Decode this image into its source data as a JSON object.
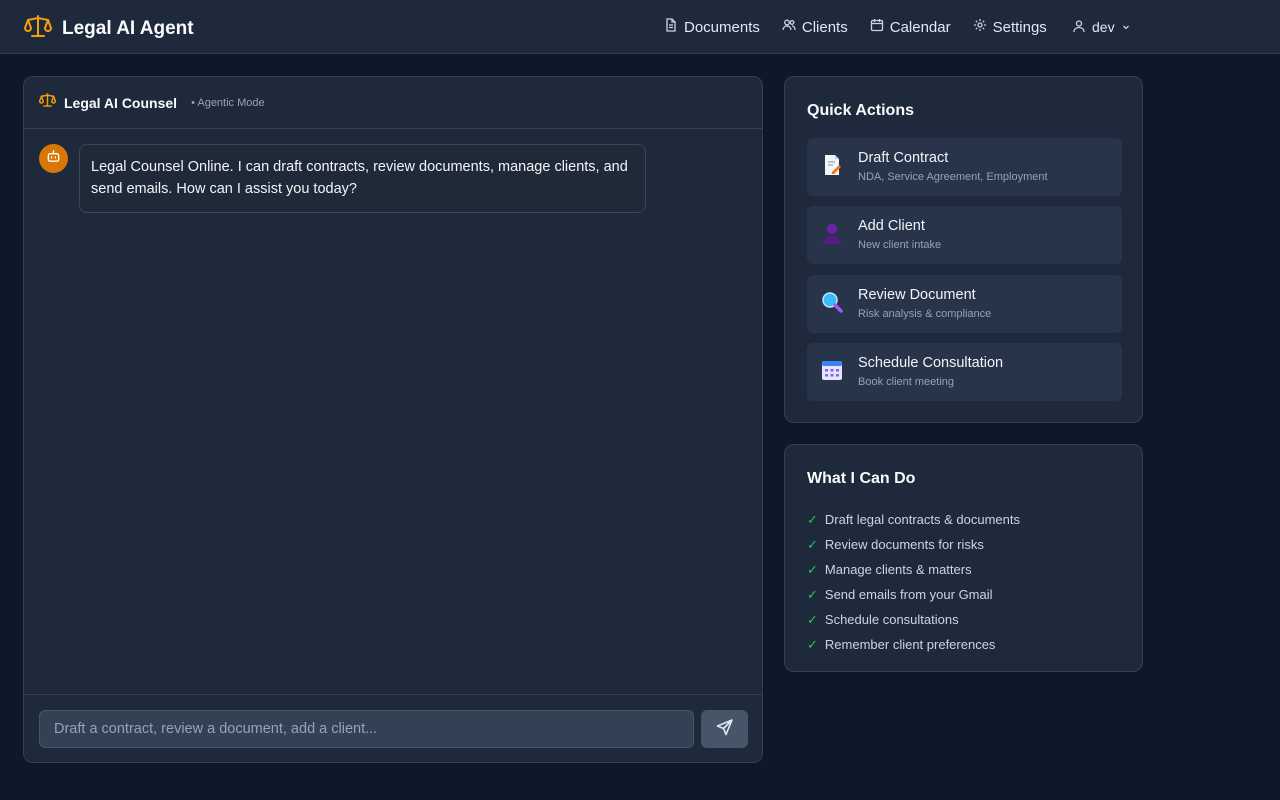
{
  "header": {
    "brand": "Legal AI Agent",
    "nav": [
      {
        "label": "Documents",
        "icon": "document-icon"
      },
      {
        "label": "Clients",
        "icon": "users-icon"
      },
      {
        "label": "Calendar",
        "icon": "calendar-icon"
      },
      {
        "label": "Settings",
        "icon": "gear-icon"
      }
    ],
    "user": "dev"
  },
  "chat": {
    "title": "Legal AI Counsel",
    "mode": "• Agentic Mode",
    "messages": [
      {
        "from": "bot",
        "text": "Legal Counsel Online. I can draft contracts, review documents, manage clients, and send emails. How can I assist you today?"
      }
    ],
    "input_placeholder": "Draft a contract, review a document, add a client...",
    "input_value": ""
  },
  "quick_actions": {
    "title": "Quick Actions",
    "items": [
      {
        "label": "Draft Contract",
        "sub": "NDA, Service Agreement, Employment",
        "icon": "memo-icon"
      },
      {
        "label": "Add Client",
        "sub": "New client intake",
        "icon": "person-icon"
      },
      {
        "label": "Review Document",
        "sub": "Risk analysis & compliance",
        "icon": "magnifier-icon"
      },
      {
        "label": "Schedule Consultation",
        "sub": "Book client meeting",
        "icon": "calendar-icon"
      }
    ]
  },
  "capabilities": {
    "title": "What I Can Do",
    "check": "✓",
    "items": [
      "Draft legal contracts & documents",
      "Review documents for risks",
      "Manage clients & matters",
      "Send emails from your Gmail",
      "Schedule consultations",
      "Remember client preferences"
    ]
  },
  "colors": {
    "background": "#0f172a",
    "panel": "#1e293b",
    "accent": "#d97706",
    "check": "#22c55e"
  }
}
